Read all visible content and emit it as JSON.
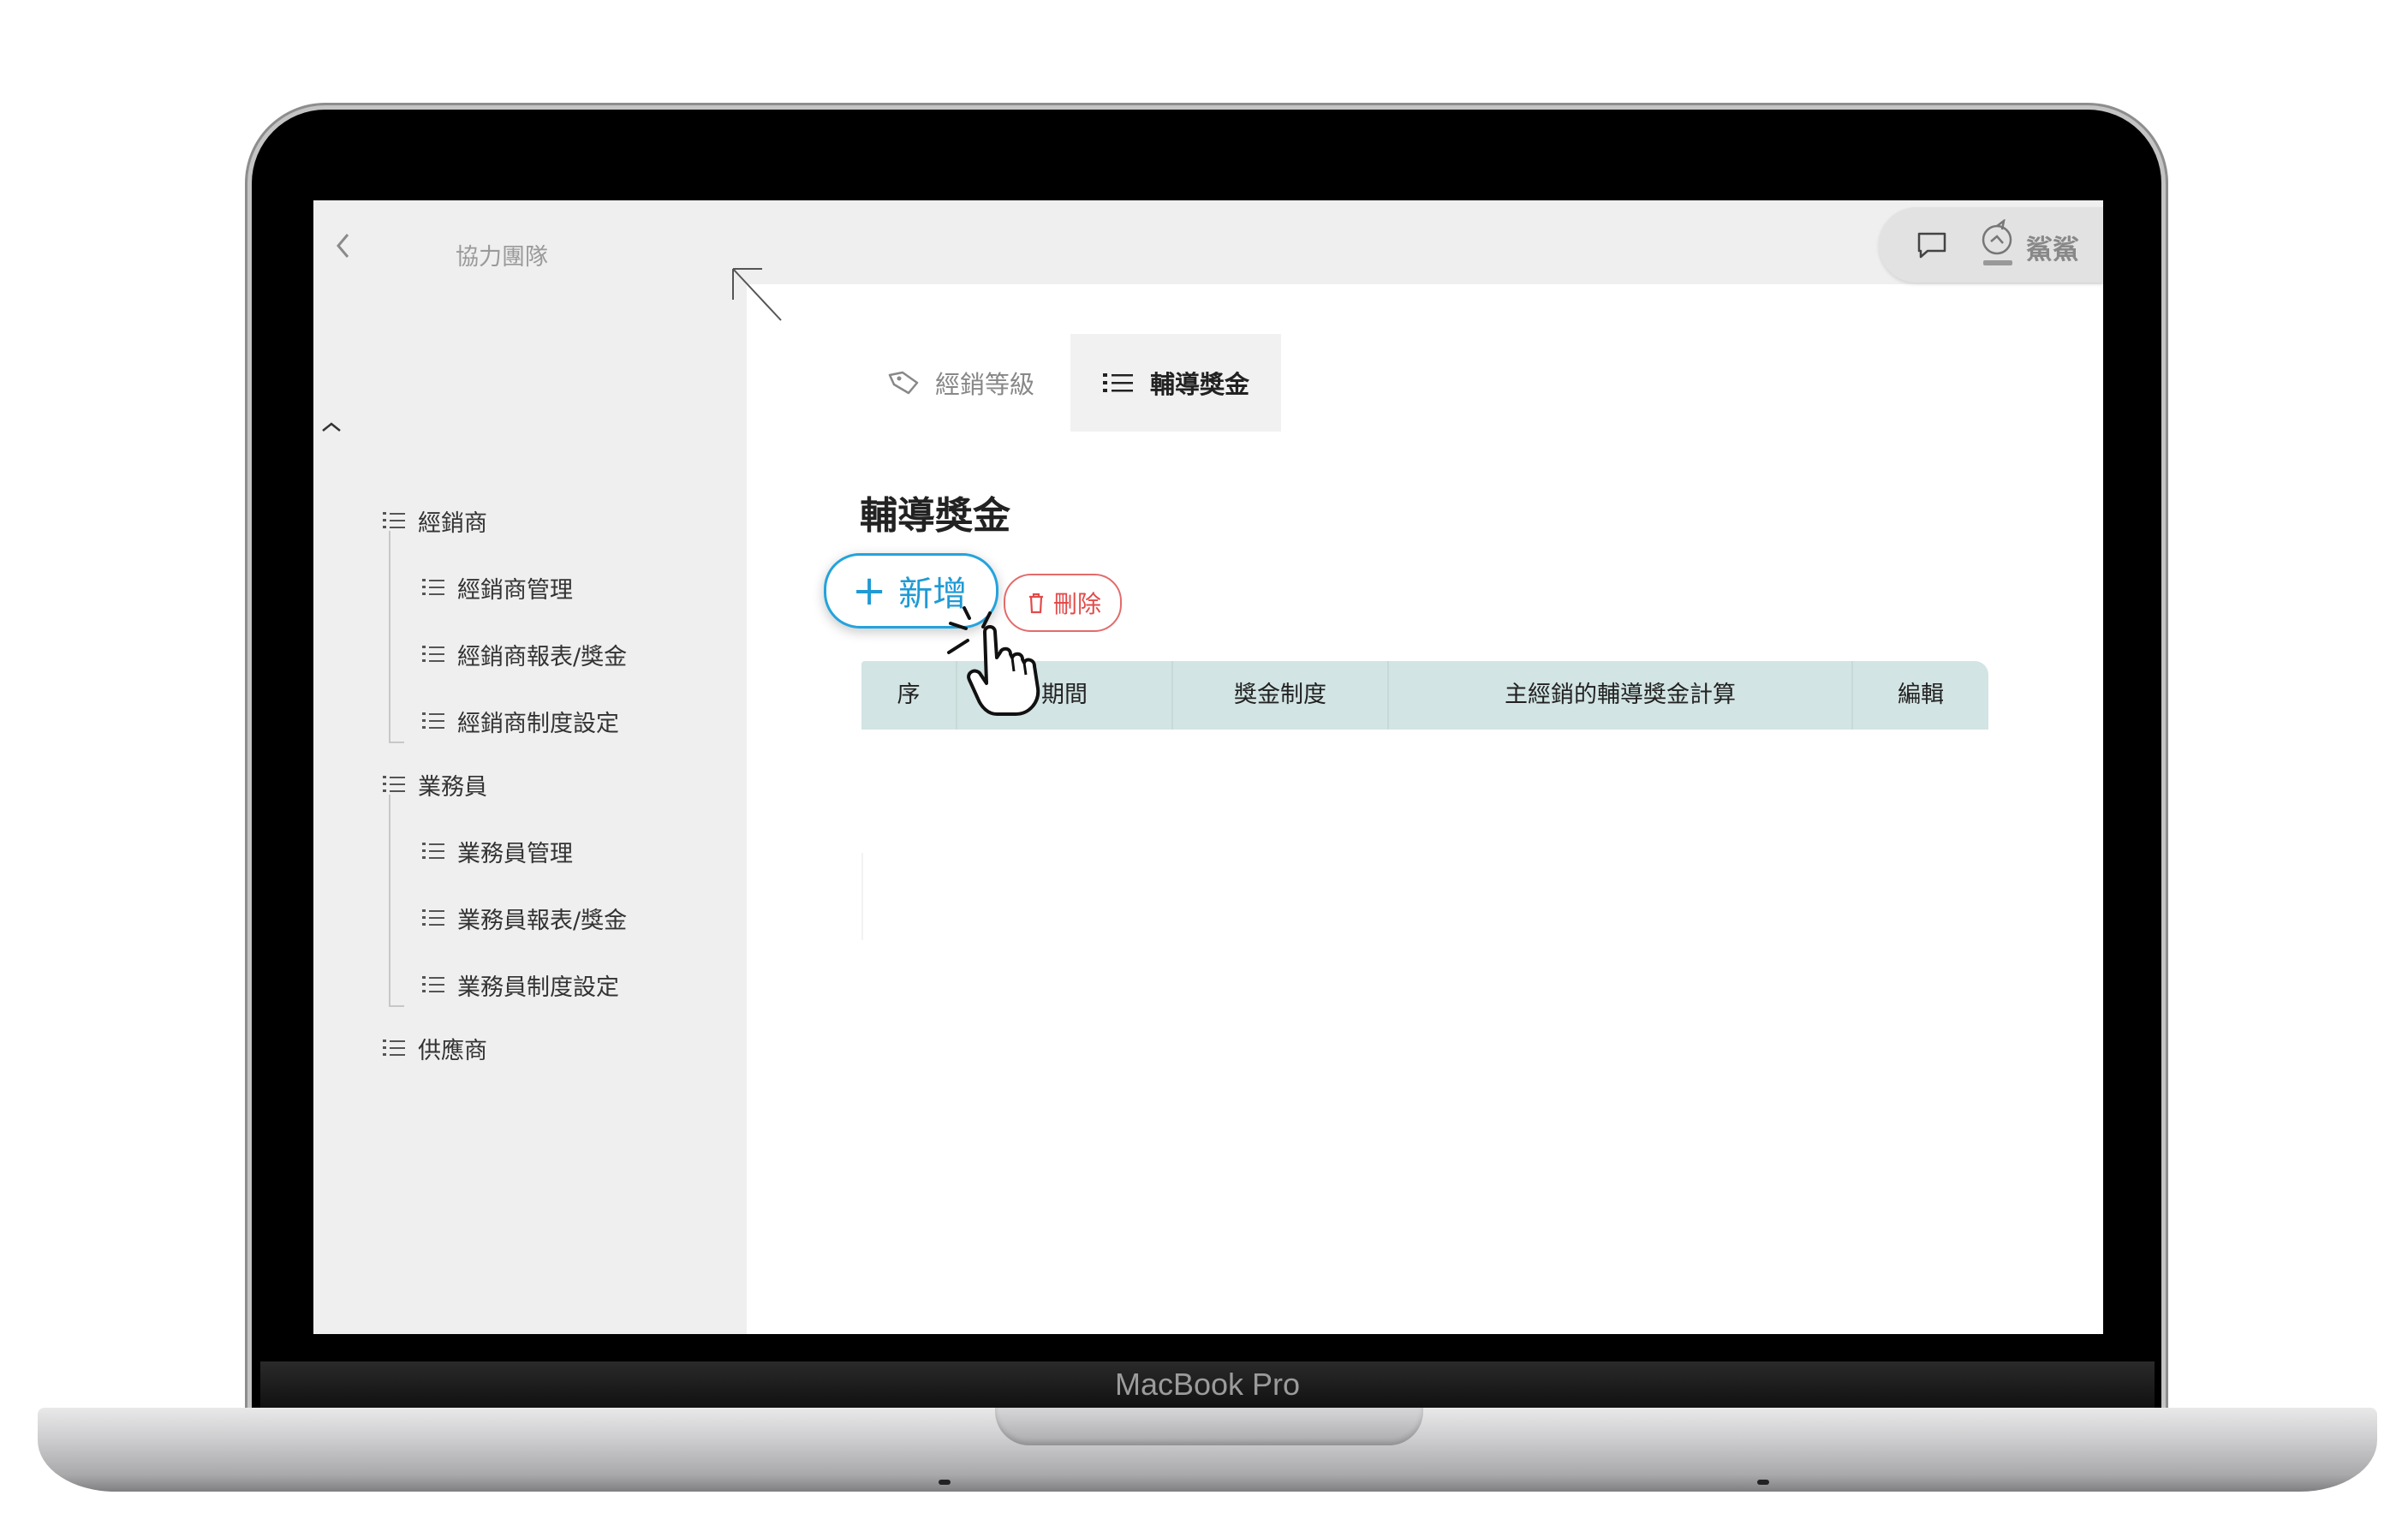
{
  "device": {
    "label": "MacBook Pro"
  },
  "sidebar": {
    "title": "協力團隊",
    "groups": [
      {
        "label": "經銷商",
        "children": [
          "經銷商管理",
          "經銷商報表/獎金",
          "經銷商制度設定"
        ]
      },
      {
        "label": "業務員",
        "children": [
          "業務員管理",
          "業務員報表/獎金",
          "業務員制度設定"
        ]
      },
      {
        "label": "供應商",
        "children": []
      }
    ]
  },
  "header": {
    "user_name": "鯊鯊"
  },
  "tabs": [
    {
      "label": "經銷等級",
      "icon": "tag-icon",
      "active": false
    },
    {
      "label": "輔導獎金",
      "icon": "list-icon",
      "active": true
    }
  ],
  "main": {
    "title": "輔導獎金",
    "add_label": "新增",
    "delete_label": "刪除",
    "table_columns": [
      "序",
      "期間",
      "獎金制度",
      "主經銷的輔導獎金計算",
      "編輯"
    ]
  },
  "colors": {
    "primary": "#23a3dd",
    "danger": "#e34a4a",
    "table_header_bg": "#d2e4e3",
    "sidebar_bg": "#efefef"
  }
}
